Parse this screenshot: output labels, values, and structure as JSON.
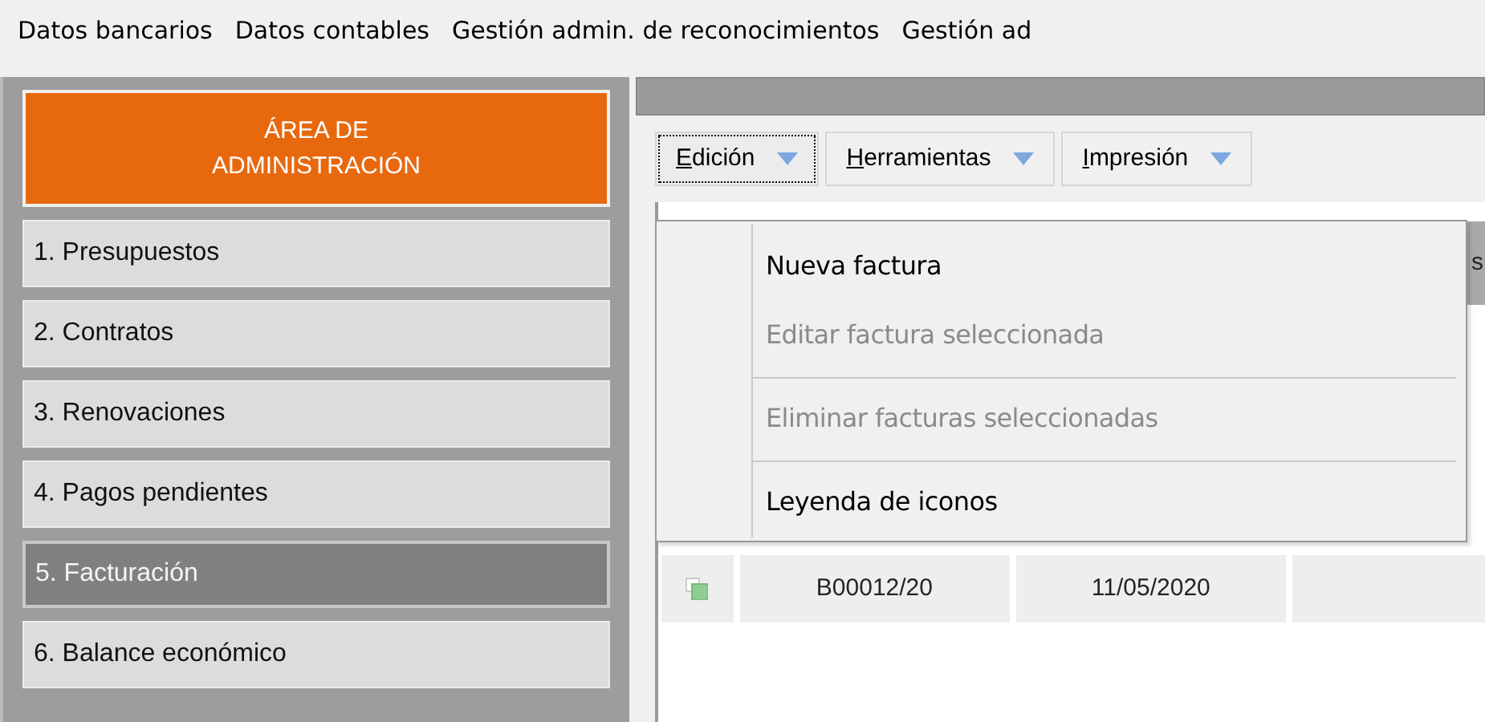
{
  "menu_bar": [
    "Datos bancarios",
    "Datos contables",
    "Gestión admin. de reconocimientos",
    "Gestión ad"
  ],
  "sidebar": {
    "title": "ÁREA DE ADMINISTRACIÓN",
    "items": [
      {
        "label": "1. Presupuestos",
        "selected": false
      },
      {
        "label": "2. Contratos",
        "selected": false
      },
      {
        "label": "3. Renovaciones",
        "selected": false
      },
      {
        "label": "4. Pagos pendientes",
        "selected": false
      },
      {
        "label": "5. Facturación",
        "selected": true
      },
      {
        "label": "6. Balance económico",
        "selected": false
      }
    ]
  },
  "toolbar": [
    {
      "label": "Edición",
      "focused": true
    },
    {
      "label": "Herramientas",
      "focused": false
    },
    {
      "label": "Impresión",
      "focused": false
    }
  ],
  "dropdown": [
    {
      "label": "Nueva factura",
      "disabled": false,
      "separator_after": false
    },
    {
      "label": "Editar factura seleccionada",
      "disabled": true,
      "separator_after": true
    },
    {
      "label": "Eliminar facturas seleccionadas",
      "disabled": true,
      "separator_after": true
    },
    {
      "label": "Leyenda de iconos",
      "disabled": false,
      "separator_after": false
    }
  ],
  "table": {
    "header_fragment": "s",
    "rows": [
      {
        "number": "B00012/20",
        "date": "11/05/2020"
      }
    ]
  }
}
